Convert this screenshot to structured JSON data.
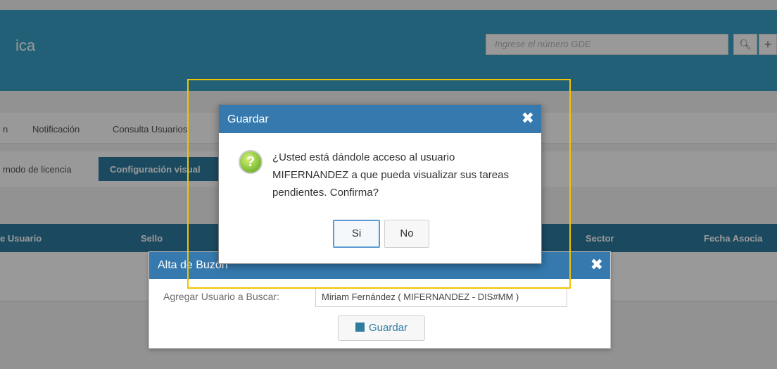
{
  "header": {
    "brand_fragment": "ica",
    "gde_search_placeholder": "Ingrese el número GDE",
    "search_icon": "search-icon",
    "plus_icon": "plus-icon"
  },
  "nav": {
    "items": [
      "n",
      "Notificación",
      "Consulta Usuarios"
    ]
  },
  "subnav": {
    "link": "modo de licencia",
    "active": "Configuración visual"
  },
  "table": {
    "columns": [
      "e Usuario",
      "Sello",
      "Sector",
      "Fecha Asocia"
    ]
  },
  "buzon_dialog": {
    "title": "Alta de Buzón",
    "close": "✖",
    "field_label": "Agregar Usuario a Buscar:",
    "field_value": "Miriam Fernández ( MIFERNANDEZ - DIS#MM )",
    "save_label": "Guardar",
    "save_icon": "floppy-disk-icon"
  },
  "confirm_dialog": {
    "title": "Guardar",
    "close": "✖",
    "icon": "question-icon",
    "icon_glyph": "?",
    "message": "¿Usted está dándole acceso al usuario MIFERNANDEZ a que pueda visualizar sus tareas pendientes. Confirma?",
    "yes_label": "Si",
    "no_label": "No"
  },
  "colors": {
    "header_blue": "#3579ae",
    "highlight": "#f2c200",
    "accent": "#2e7ca0"
  }
}
